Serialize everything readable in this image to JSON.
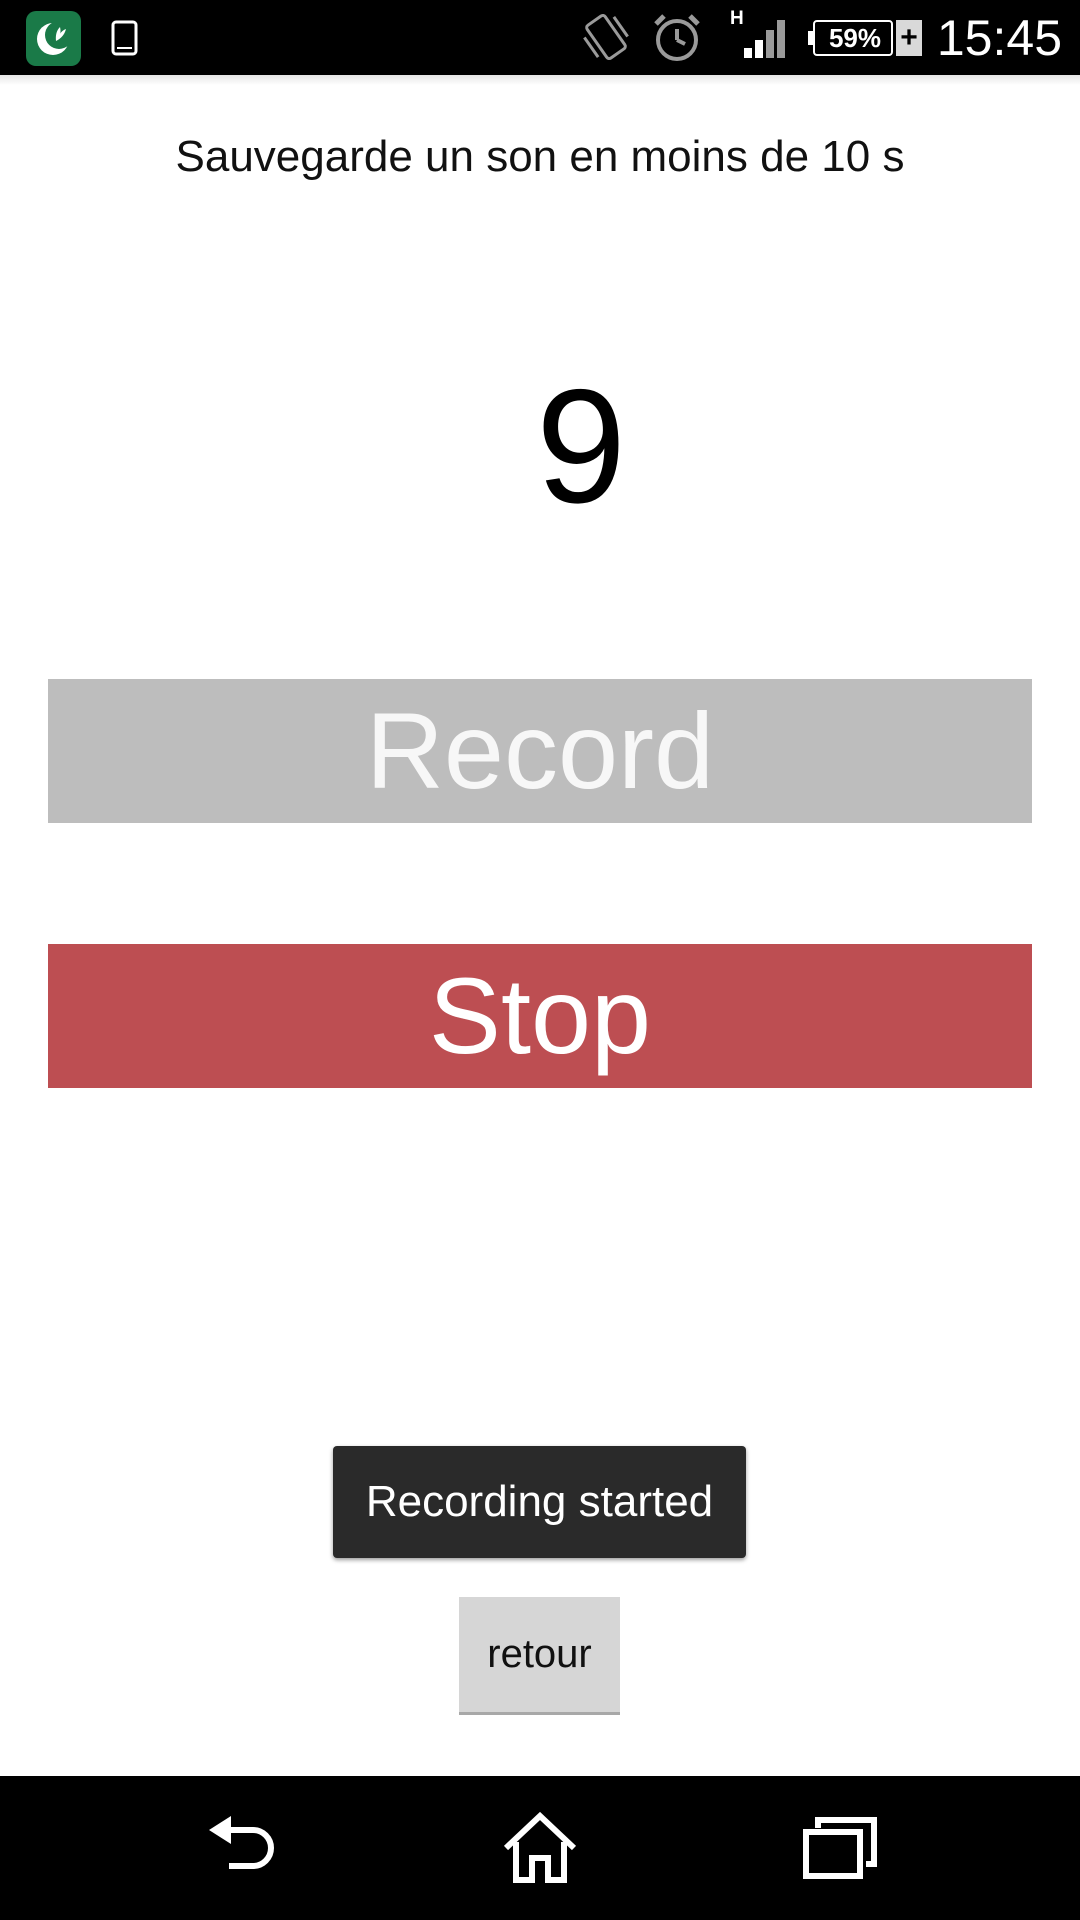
{
  "status_bar": {
    "network_type": "H",
    "battery_percent": "59%",
    "charging_symbol": "+",
    "time": "15:45",
    "icons": [
      "app-notification-icon",
      "phone-icon",
      "vibrate-icon",
      "alarm-icon",
      "signal-icon",
      "battery-icon",
      "charging-icon"
    ]
  },
  "main": {
    "instruction": "Sauvegarde un son en moins de 10 s",
    "countdown": "9",
    "record_label": "Record",
    "stop_label": "Stop",
    "back_label": "retour"
  },
  "toast": {
    "message": "Recording started"
  },
  "nav_bar": {
    "icons": [
      "back-icon",
      "home-icon",
      "recent-apps-icon"
    ]
  },
  "colors": {
    "record_button": "#bdbdbd",
    "stop_button": "#bd4e52",
    "toast_background": "#2a2a2a",
    "back_button": "#d6d6d6"
  }
}
